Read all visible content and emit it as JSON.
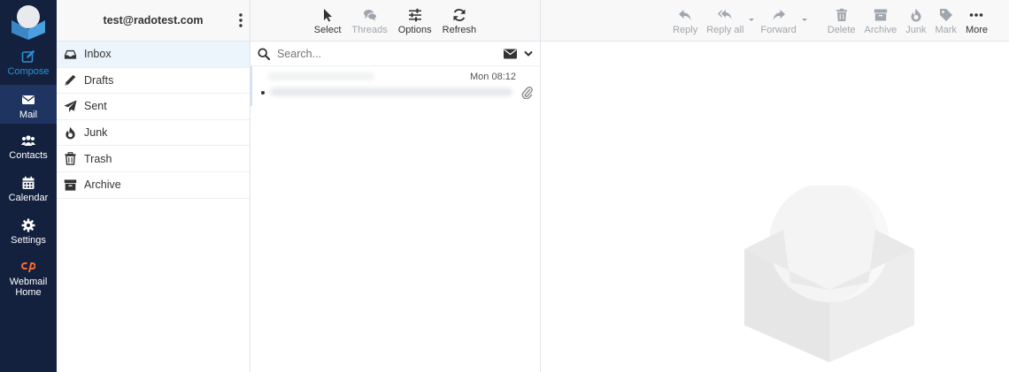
{
  "nav": {
    "items": [
      {
        "label": "Compose",
        "icon": "compose-icon"
      },
      {
        "label": "Mail",
        "icon": "envelope-icon"
      },
      {
        "label": "Contacts",
        "icon": "users-icon"
      },
      {
        "label": "Calendar",
        "icon": "calendar-icon"
      },
      {
        "label": "Settings",
        "icon": "gear-icon"
      },
      {
        "label": "Webmail Home",
        "icon": "cpanel-icon"
      }
    ]
  },
  "account": {
    "email": "test@radotest.com"
  },
  "folders": [
    {
      "label": "Inbox",
      "icon": "inbox-icon"
    },
    {
      "label": "Drafts",
      "icon": "pencil-icon"
    },
    {
      "label": "Sent",
      "icon": "paper-plane-icon"
    },
    {
      "label": "Junk",
      "icon": "fire-icon"
    },
    {
      "label": "Trash",
      "icon": "trash-icon"
    },
    {
      "label": "Archive",
      "icon": "archive-icon"
    }
  ],
  "list_toolbar": {
    "select": "Select",
    "threads": "Threads",
    "options": "Options",
    "refresh": "Refresh"
  },
  "search": {
    "placeholder": "Search..."
  },
  "messages": [
    {
      "date": "Mon 08:12",
      "has_attachment": true
    }
  ],
  "preview_toolbar": {
    "reply": "Reply",
    "reply_all": "Reply all",
    "forward": "Forward",
    "delete": "Delete",
    "archive": "Archive",
    "junk": "Junk",
    "mark": "Mark",
    "more": "More"
  },
  "colors": {
    "nav_bg": "#13213f",
    "accent": "#2d90d6",
    "selected_folder_bg": "#ecf5fc"
  }
}
